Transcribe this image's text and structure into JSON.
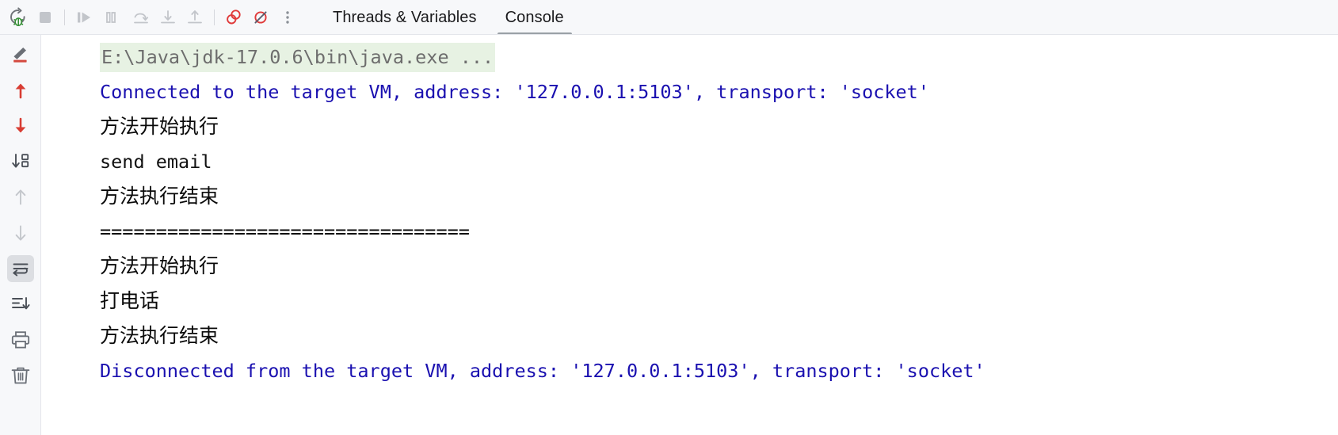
{
  "toolbar": {
    "buttons": [
      {
        "name": "rerun-debug-button",
        "icon": "rerun-bug-icon",
        "title": "Rerun"
      },
      {
        "name": "stop-button",
        "icon": "stop-square-icon",
        "title": "Stop"
      },
      {
        "name": "separator-1",
        "icon": "separator",
        "title": ""
      },
      {
        "name": "resume-program-button",
        "icon": "resume-play-icon",
        "title": "Resume Program"
      },
      {
        "name": "pause-program-button",
        "icon": "pause-icon",
        "title": "Pause Program"
      },
      {
        "name": "step-over-button",
        "icon": "step-over-icon",
        "title": "Step Over"
      },
      {
        "name": "step-into-button",
        "icon": "step-into-icon",
        "title": "Step Into"
      },
      {
        "name": "step-out-button",
        "icon": "step-out-icon",
        "title": "Step Out"
      },
      {
        "name": "separator-2",
        "icon": "separator",
        "title": ""
      },
      {
        "name": "view-breakpoints-button",
        "icon": "breakpoints-circles-icon",
        "title": "View Breakpoints"
      },
      {
        "name": "mute-breakpoints-button",
        "icon": "mute-breakpoints-icon",
        "title": "Mute Breakpoints"
      },
      {
        "name": "more-options-button",
        "icon": "more-vertical-dots-icon",
        "title": "More"
      }
    ],
    "colors": {
      "accent_red": "#db3b3b",
      "accent_green": "#389038",
      "icon_gray": "#9aa0a6",
      "bar_background": "#f7f8fa"
    }
  },
  "tabs": [
    {
      "label": "Threads & Variables",
      "name": "tab-threads-and-variables",
      "selected": false
    },
    {
      "label": "Console",
      "name": "tab-console",
      "selected": true
    }
  ],
  "gutter": {
    "buttons": [
      {
        "name": "soft-wrap-edit-icon",
        "icon": "pencil-underline-icon",
        "active": false
      },
      {
        "name": "previous-occurrence-button",
        "icon": "arrow-up-red-icon",
        "active": false
      },
      {
        "name": "next-occurrence-button",
        "icon": "arrow-down-red-icon",
        "active": false
      },
      {
        "name": "jump-to-source-button",
        "icon": "arrow-down-box-icon",
        "active": false
      },
      {
        "name": "scroll-up-button",
        "icon": "arrow-up-gray-icon",
        "active": false
      },
      {
        "name": "scroll-down-button",
        "icon": "arrow-down-gray-icon",
        "active": false
      },
      {
        "name": "soft-wrap-button",
        "icon": "soft-wrap-icon",
        "active": true
      },
      {
        "name": "scroll-to-end-button",
        "icon": "scroll-to-end-icon",
        "active": false
      },
      {
        "name": "print-button",
        "icon": "printer-icon",
        "active": false
      },
      {
        "name": "clear-all-button",
        "icon": "trash-icon",
        "active": false
      }
    ]
  },
  "console": {
    "lines": [
      {
        "name": "console-line-command",
        "kind": "cmd",
        "text": "E:\\Java\\jdk-17.0.6\\bin\\java.exe ...",
        "highlight": true
      },
      {
        "name": "console-line-connected",
        "kind": "vm",
        "text": "Connected to the target VM, address: '127.0.0.1:5103', transport: 'socket'",
        "highlight": false
      },
      {
        "name": "console-line-method-start-1",
        "kind": "cjk",
        "text": "方法开始执行",
        "highlight": false
      },
      {
        "name": "console-line-send-email",
        "kind": "out",
        "text": "send email",
        "highlight": false
      },
      {
        "name": "console-line-method-end-1",
        "kind": "cjk",
        "text": "方法执行结束",
        "highlight": false
      },
      {
        "name": "console-line-separator",
        "kind": "sep",
        "text": "=================================",
        "highlight": false
      },
      {
        "name": "console-line-method-start-2",
        "kind": "cjk",
        "text": "方法开始执行",
        "highlight": false
      },
      {
        "name": "console-line-make-call",
        "kind": "cjk",
        "text": "打电话",
        "highlight": false
      },
      {
        "name": "console-line-method-end-2",
        "kind": "cjk",
        "text": "方法执行结束",
        "highlight": false
      },
      {
        "name": "console-line-disconnected",
        "kind": "vm",
        "text": "Disconnected from the target VM, address: '127.0.0.1:5103', transport: 'socket'",
        "highlight": false
      }
    ]
  }
}
